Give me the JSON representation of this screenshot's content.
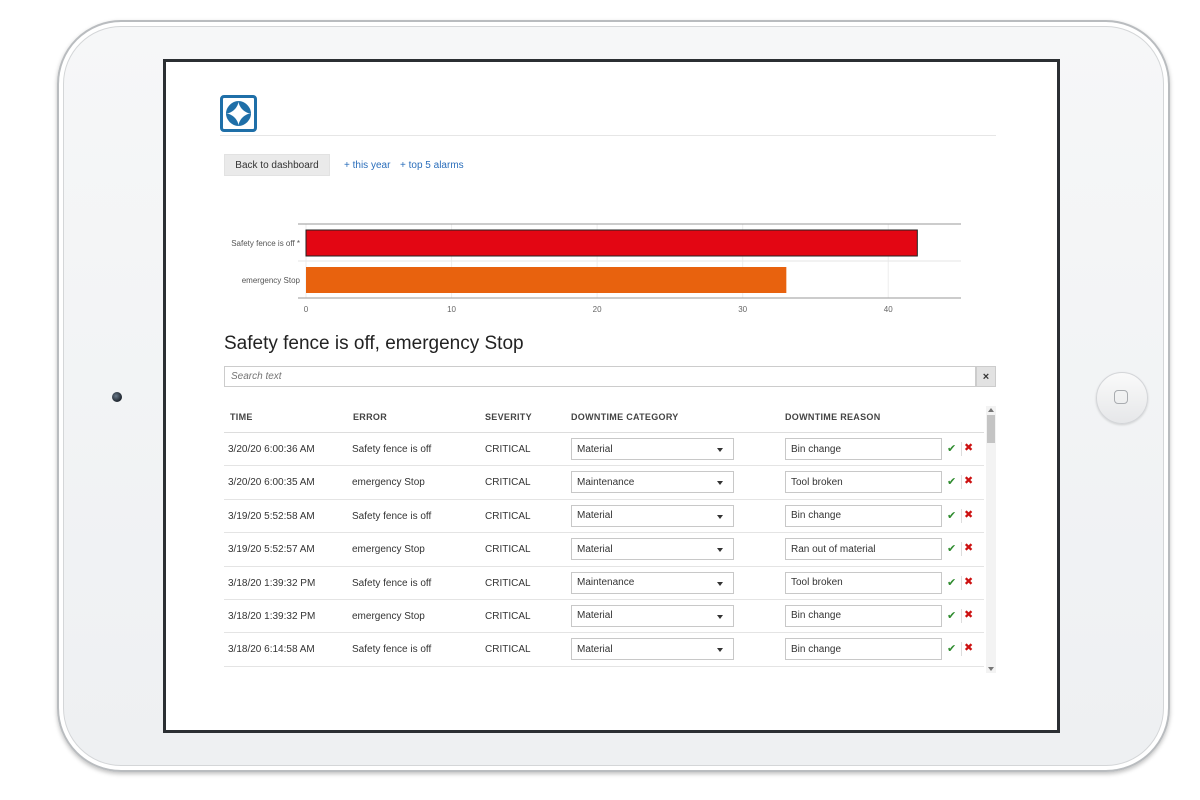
{
  "nav": {
    "back_label": "Back to dashboard",
    "links": [
      "+ this year",
      "+ top 5 alarms"
    ]
  },
  "chart_data": {
    "type": "bar",
    "orientation": "horizontal",
    "categories": [
      "Safety fence is off *",
      "emergency Stop"
    ],
    "values": [
      42,
      33
    ],
    "colors": [
      "#e30613",
      "#e8620e"
    ],
    "xlim": [
      0,
      45
    ],
    "xticks": [
      0,
      10,
      20,
      30,
      40
    ],
    "grid": true
  },
  "title": "Safety fence is off, emergency Stop",
  "search": {
    "placeholder": "Search text",
    "clear_label": "×"
  },
  "table": {
    "columns": [
      "TIME",
      "ERROR",
      "SEVERITY",
      "DOWNTIME CATEGORY",
      "DOWNTIME REASON"
    ],
    "rows": [
      {
        "time": "3/20/20 6:00:36 AM",
        "error": "Safety fence is off",
        "severity": "CRITICAL",
        "category": "Material",
        "reason": "Bin change"
      },
      {
        "time": "3/20/20 6:00:35 AM",
        "error": "emergency Stop",
        "severity": "CRITICAL",
        "category": "Maintenance",
        "reason": "Tool broken"
      },
      {
        "time": "3/19/20 5:52:58 AM",
        "error": "Safety fence is off",
        "severity": "CRITICAL",
        "category": "Material",
        "reason": "Bin change"
      },
      {
        "time": "3/19/20 5:52:57 AM",
        "error": "emergency Stop",
        "severity": "CRITICAL",
        "category": "Material",
        "reason": "Ran out of material"
      },
      {
        "time": "3/18/20 1:39:32 PM",
        "error": "Safety fence is off",
        "severity": "CRITICAL",
        "category": "Maintenance",
        "reason": "Tool broken"
      },
      {
        "time": "3/18/20 1:39:32 PM",
        "error": "emergency Stop",
        "severity": "CRITICAL",
        "category": "Material",
        "reason": "Bin change"
      },
      {
        "time": "3/18/20 6:14:58 AM",
        "error": "Safety fence is off",
        "severity": "CRITICAL",
        "category": "Material",
        "reason": "Bin change"
      }
    ],
    "confirm_icon": "check-icon",
    "reject_icon": "x-icon"
  },
  "colors": {
    "accent": "#2a6ebb",
    "logo": "#1f6fa8",
    "confirm": "#2e8b2e",
    "reject": "#cc1111"
  }
}
